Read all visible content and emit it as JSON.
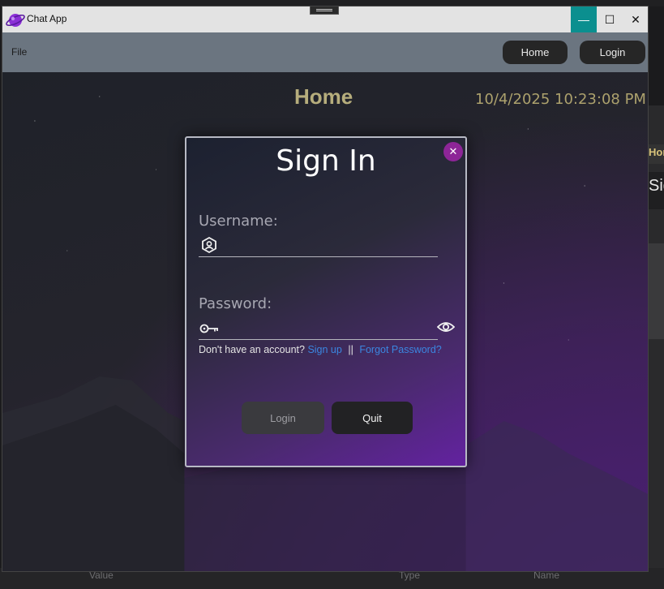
{
  "window": {
    "title": "Chat App",
    "controls": {
      "minimize": "—",
      "maximize": "☐",
      "close": "✕"
    }
  },
  "menu": {
    "file": "File"
  },
  "nav": {
    "home": "Home",
    "login": "Login"
  },
  "page": {
    "title": "Home",
    "datetime": "10/4/2025 10:23:08 PM"
  },
  "dialog": {
    "title": "Sign In",
    "close_icon": "✕",
    "username_label": "Username:",
    "username_value": "",
    "password_label": "Password:",
    "password_value": "",
    "account_prompt": "Don't have an account?",
    "signup_link": "Sign up",
    "separator": "||",
    "forgot_link": "Forgot Password?",
    "login_button": "Login",
    "quit_button": "Quit"
  },
  "background": {
    "right_panel_header": "Hor",
    "right_panel_text": "Sign",
    "bottom_value": "Value",
    "bottom_type": "Type",
    "bottom_name": "Name"
  },
  "colors": {
    "minimize_accent": "#0b8f8f",
    "menubar": "#6b7580",
    "page_title": "#b6ad7c",
    "link": "#3b86e0",
    "dialog_close": "#8d2597"
  },
  "icons": [
    "app-logo-icon",
    "user-badge-icon",
    "key-icon",
    "eye-icon"
  ]
}
